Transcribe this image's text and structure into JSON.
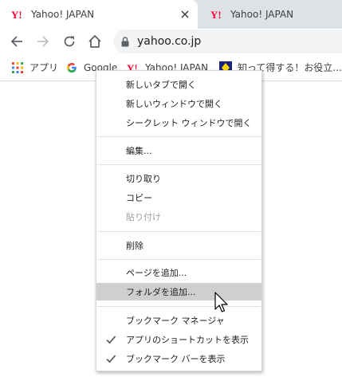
{
  "tabs": [
    {
      "title": "Yahoo! JAPAN",
      "active": true,
      "favicon": "yahoo-y-icon"
    },
    {
      "title": "Yahoo! JAPAN",
      "active": false,
      "favicon": "yahoo-y-icon"
    }
  ],
  "toolbar": {
    "url": "yahoo.co.jp"
  },
  "bookmarks": [
    {
      "label": "アプリ",
      "icon": "apps-grid-icon"
    },
    {
      "label": "Google",
      "icon": "google-g-icon"
    },
    {
      "label": "Yahoo! JAPAN",
      "icon": "yahoo-y-icon"
    },
    {
      "label": "知って得する！お役立...",
      "icon": "diamond-site-icon"
    }
  ],
  "menu": {
    "items": [
      {
        "label": "新しいタブで開く",
        "disabled": false
      },
      {
        "label": "新しいウィンドウで開く",
        "disabled": false
      },
      {
        "label": "シークレット ウィンドウで開く",
        "disabled": false
      },
      {
        "label": "編集...",
        "disabled": false
      },
      {
        "label": "切り取り",
        "disabled": false
      },
      {
        "label": "コピー",
        "disabled": false
      },
      {
        "label": "貼り付け",
        "disabled": true
      },
      {
        "label": "削除",
        "disabled": false
      },
      {
        "label": "ページを追加...",
        "disabled": false
      },
      {
        "label": "フォルダを追加...",
        "disabled": false,
        "hovered": true
      },
      {
        "label": "ブックマーク マネージャ",
        "disabled": false
      },
      {
        "label": "アプリのショートカットを表示",
        "disabled": false,
        "checked": true
      },
      {
        "label": "ブックマーク バーを表示",
        "disabled": false,
        "checked": true
      }
    ]
  },
  "colors": {
    "tabstrip": "#dee1e6",
    "yahoo_red": "#ff0033",
    "menu_hover": "#cfcfcf",
    "disabled_text": "#9aa0a6"
  }
}
